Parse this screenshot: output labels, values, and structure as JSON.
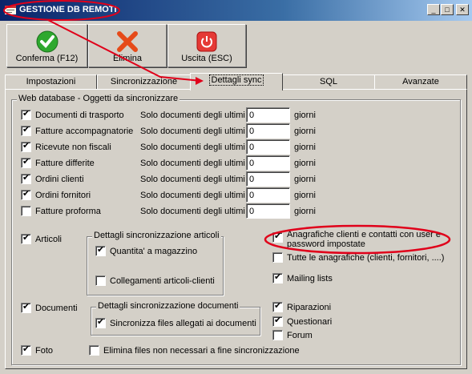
{
  "window": {
    "title": "GESTIONE DB REMOTI"
  },
  "toolbar": {
    "confirm_label": "Conferma (F12)",
    "delete_label": "Elimina",
    "exit_label": "Uscita (ESC)"
  },
  "tabs": [
    "Impostazioni",
    "Sincronizzazione",
    "Dettagli sync",
    "SQL",
    "Avanzate"
  ],
  "active_tab": "Dettagli sync",
  "group_main": {
    "title": "Web database - Oggetti da sincronizzare"
  },
  "doc_types": [
    {
      "label": "Documenti di trasporto",
      "checked": true,
      "value": "0"
    },
    {
      "label": "Fatture accompagnatorie",
      "checked": true,
      "value": "0"
    },
    {
      "label": "Ricevute non fiscali",
      "checked": true,
      "value": "0"
    },
    {
      "label": "Fatture differite",
      "checked": true,
      "value": "0"
    },
    {
      "label": "Ordini clienti",
      "checked": true,
      "value": "0"
    },
    {
      "label": "Ordini fornitori",
      "checked": true,
      "value": "0"
    },
    {
      "label": "Fatture proforma",
      "checked": false,
      "value": "0"
    }
  ],
  "row_prefix": "Solo documenti degli ultimi",
  "row_suffix": "giorni",
  "articoli": {
    "label": "Articoli",
    "checked": true,
    "group_title": "Dettagli sincronizzazione articoli",
    "quantita": {
      "label": "Quantita' a magazzino",
      "checked": true
    },
    "collegamenti": {
      "label": "Collegamenti articoli-clienti",
      "checked": false
    }
  },
  "anagrafiche": {
    "with_user": {
      "label_line1": "Anagrafiche clienti e contatti con user e",
      "label_line2": "password impostate",
      "checked": true
    },
    "all": {
      "label": "Tutte le anagrafiche (clienti, fornitori, ....)",
      "checked": false
    },
    "mailing": {
      "label": "Mailing lists",
      "checked": true
    }
  },
  "documenti": {
    "label": "Documenti",
    "checked": true,
    "group_title": "Dettagli sincronizzazione documenti",
    "allegati": {
      "label": "Sincronizza files allegati ai documenti",
      "checked": true
    }
  },
  "extra": {
    "riparazioni": {
      "label": "Riparazioni",
      "checked": true
    },
    "questionari": {
      "label": "Questionari",
      "checked": true
    },
    "forum": {
      "label": "Forum",
      "checked": false
    }
  },
  "foto": {
    "label": "Foto",
    "checked": true,
    "elimina": {
      "label": "Elimina files non necessari a fine sincronizzazione",
      "checked": false
    }
  },
  "colors": {
    "title_start": "#0a246a",
    "annotation": "#e0001a",
    "face": "#d4d0c8"
  }
}
